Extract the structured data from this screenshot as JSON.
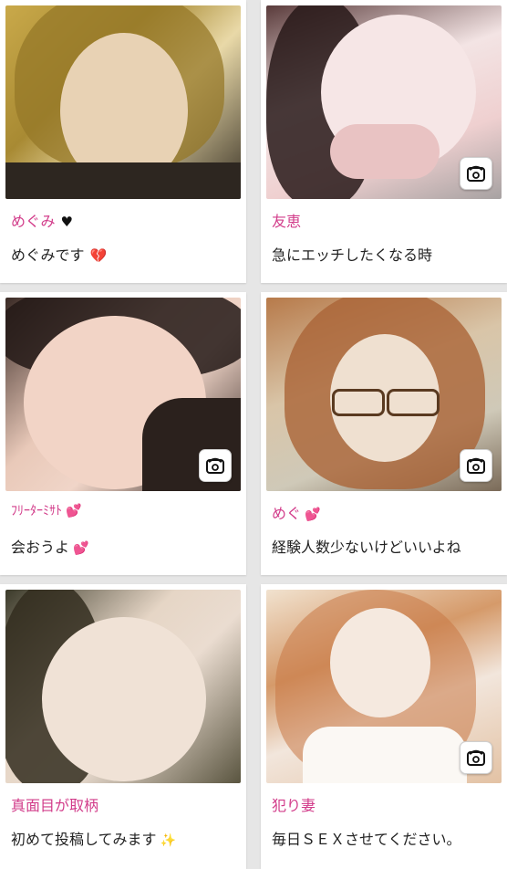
{
  "cards": [
    {
      "name": "めぐみ",
      "name_emoji": "♥",
      "message": "めぐみです",
      "message_emoji": "💔",
      "has_phone": false
    },
    {
      "name": "友恵",
      "name_emoji": "",
      "message": "急にエッチしたくなる時",
      "message_emoji": "",
      "has_phone": true
    },
    {
      "name": "ﾌﾘｰﾀｰﾐｻﾄ",
      "name_emoji": "💕",
      "message": "会おうよ",
      "message_emoji": "💕",
      "has_phone": true
    },
    {
      "name": "めぐ",
      "name_emoji": "💕",
      "message": "経験人数少ないけどいいよね",
      "message_emoji": "",
      "has_phone": true
    },
    {
      "name": "真面目が取柄",
      "name_emoji": "",
      "message": "初めて投稿してみます",
      "message_emoji": "✨",
      "has_phone": false
    },
    {
      "name": "犯り妻",
      "name_emoji": "",
      "message": "毎日ＳＥＸさせてください。",
      "message_emoji": "",
      "has_phone": true
    }
  ],
  "icons": {
    "phone": "phone-icon"
  },
  "colors": {
    "name": "#d23c8a",
    "background": "#e6e6e6",
    "card": "#ffffff"
  }
}
